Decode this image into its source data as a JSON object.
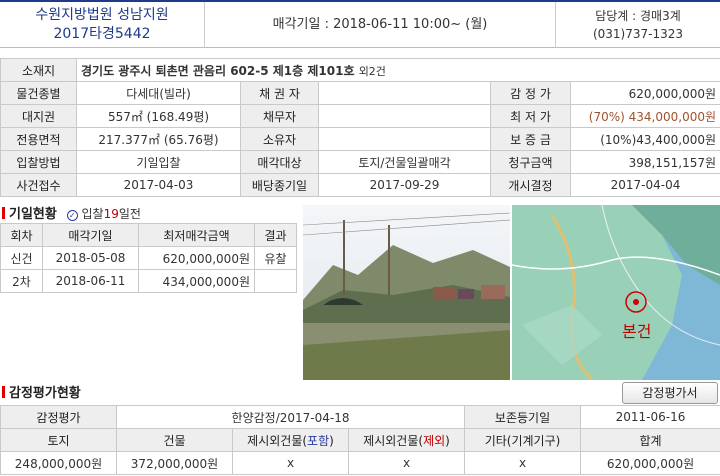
{
  "header": {
    "court": "수원지방법원 성남지원",
    "case_no": "2017타경5442",
    "sale_date": "매각기일 : 2018-06-11   10:00~ (월)",
    "dept": "담당계 : 경매3계",
    "phone": "(031)737-1323"
  },
  "main": {
    "address_label": "소재지",
    "address": "경기도 광주시 퇴촌면 관음리 602-5 제1층 제101호",
    "address_extra": "외2건",
    "rows": [
      {
        "l1": "물건종별",
        "v1": "다세대(빌라)",
        "l2": "채 권 자",
        "v2": "",
        "l3": "감 정 가",
        "v3": "620,000,000원"
      },
      {
        "l1": "대지권",
        "v1": "557㎡ (168.49평)",
        "l2": "채무자",
        "v2": "",
        "l3": "최 저 가",
        "v3": "(70%) 434,000,000원"
      },
      {
        "l1": "전용면적",
        "v1": "217.377㎡ (65.76평)",
        "l2": "소유자",
        "v2": "",
        "l3": "보 증 금",
        "v3": "(10%)43,400,000원"
      },
      {
        "l1": "입찰방법",
        "v1": "기일입찰",
        "l2": "매각대상",
        "v2": "토지/건물일괄매각",
        "l3": "청구금액",
        "v3": "398,151,157원"
      },
      {
        "l1": "사건접수",
        "v1": "2017-04-03",
        "l2": "배당종기일",
        "v2": "2017-09-29",
        "l3": "개시결정",
        "v3": "2017-04-04"
      }
    ]
  },
  "bid": {
    "title": "기일현황",
    "badge_prefix": "입찰",
    "badge_days": "19",
    "badge_suffix": "일전",
    "headers": [
      "회차",
      "매각기일",
      "최저매각금액",
      "결과"
    ],
    "rows": [
      {
        "round": "신건",
        "date": "2018-05-08",
        "amount": "620,000,000원",
        "result": "유찰"
      },
      {
        "round": "2차",
        "date": "2018-06-11",
        "amount": "434,000,000원",
        "result": ""
      }
    ]
  },
  "map": {
    "label": "본건"
  },
  "eval": {
    "title": "감정평가현황",
    "button": "감정평가서",
    "row1": {
      "l1": "감정평가",
      "v1": "한양감정/2017-04-18",
      "l2": "보존등기일",
      "v2": "2011-06-16"
    },
    "headers": [
      "토지",
      "건물",
      "제시외건물(",
      "포함",
      ")",
      "제시외건물(",
      "제외",
      ")",
      "기타(기계기구)",
      "합계"
    ],
    "values": [
      "248,000,000원",
      "372,000,000원",
      "x",
      "x",
      "x",
      "620,000,000원"
    ]
  },
  "colors": {
    "accent": "#1f3a8a",
    "red": "#c00000",
    "label_bg": "#eeeeee"
  }
}
